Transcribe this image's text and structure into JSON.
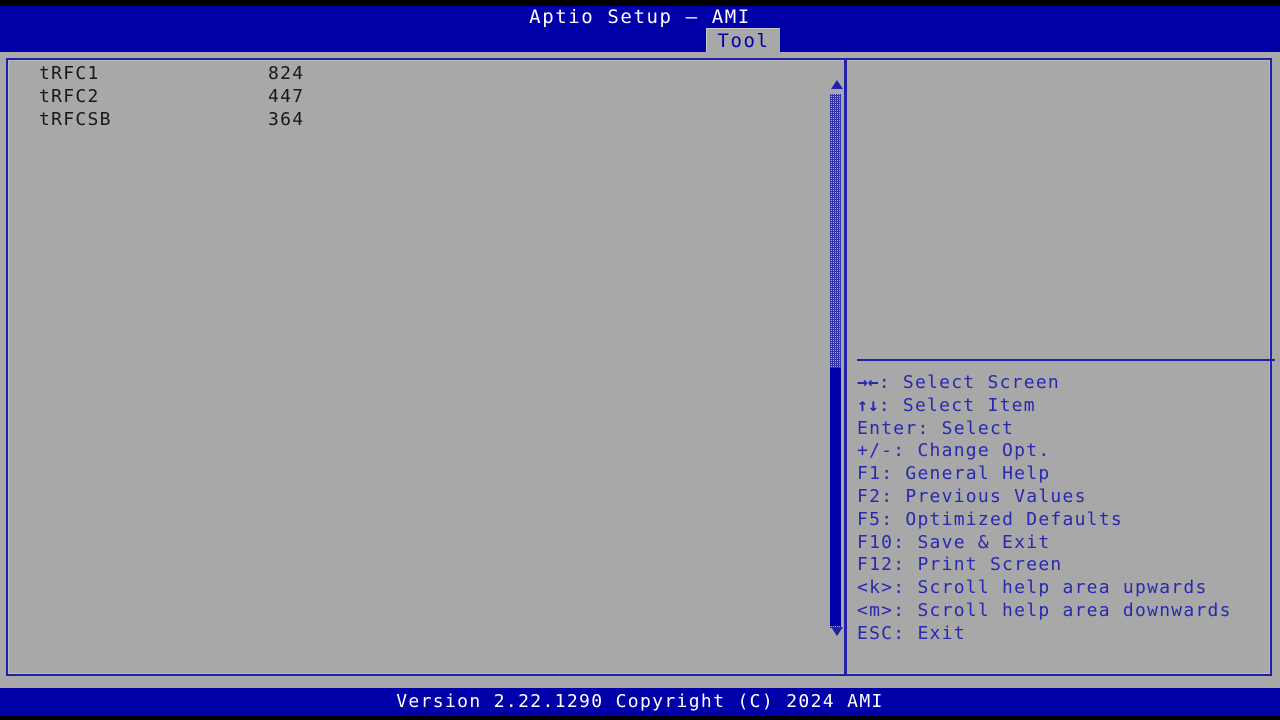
{
  "window": {
    "title": "Aptio Setup – AMI"
  },
  "colors": {
    "bios_blue": "#0000a8",
    "panel_gray": "#a8a8a8",
    "border_blue": "#2020a8",
    "help_text_blue": "#2828b0",
    "label_text": "#181818",
    "title_text": "#ffffff"
  },
  "tabs": [
    {
      "label": "Tool",
      "selected": true
    }
  ],
  "left_pane": {
    "rows": [
      {
        "label": "tRFC1",
        "value": "824"
      },
      {
        "label": "tRFC2",
        "value": "447"
      },
      {
        "label": "tRFCSB",
        "value": "364"
      }
    ]
  },
  "scrollbar": {
    "up_arrow_icon": "triangle-up-icon",
    "down_arrow_icon": "triangle-down-icon",
    "thumb_position_percent": 88
  },
  "help_pane": {
    "description": "",
    "keys": [
      {
        "glyph": "→←",
        "key": "",
        "sep": ": ",
        "action": "Select Screen"
      },
      {
        "glyph": "↑↓",
        "key": "",
        "sep": ": ",
        "action": "Select Item"
      },
      {
        "glyph": "",
        "key": "Enter",
        "sep": ": ",
        "action": "Select"
      },
      {
        "glyph": "",
        "key": "+/-",
        "sep": ": ",
        "action": "Change Opt."
      },
      {
        "glyph": "",
        "key": "F1",
        "sep": ": ",
        "action": "General Help"
      },
      {
        "glyph": "",
        "key": "F2",
        "sep": ": ",
        "action": "Previous Values"
      },
      {
        "glyph": "",
        "key": "F5",
        "sep": ": ",
        "action": "Optimized Defaults"
      },
      {
        "glyph": "",
        "key": "F10",
        "sep": ": ",
        "action": "Save & Exit"
      },
      {
        "glyph": "",
        "key": "F12",
        "sep": ": ",
        "action": "Print Screen"
      },
      {
        "glyph": "",
        "key": "<k>",
        "sep": ": ",
        "action": "Scroll help area upwards"
      },
      {
        "glyph": "",
        "key": "<m>",
        "sep": ": ",
        "action": "Scroll help area downwards"
      },
      {
        "glyph": "",
        "key": "ESC",
        "sep": ": ",
        "action": "Exit"
      }
    ]
  },
  "footer": {
    "text": "Version 2.22.1290 Copyright (C) 2024 AMI"
  }
}
